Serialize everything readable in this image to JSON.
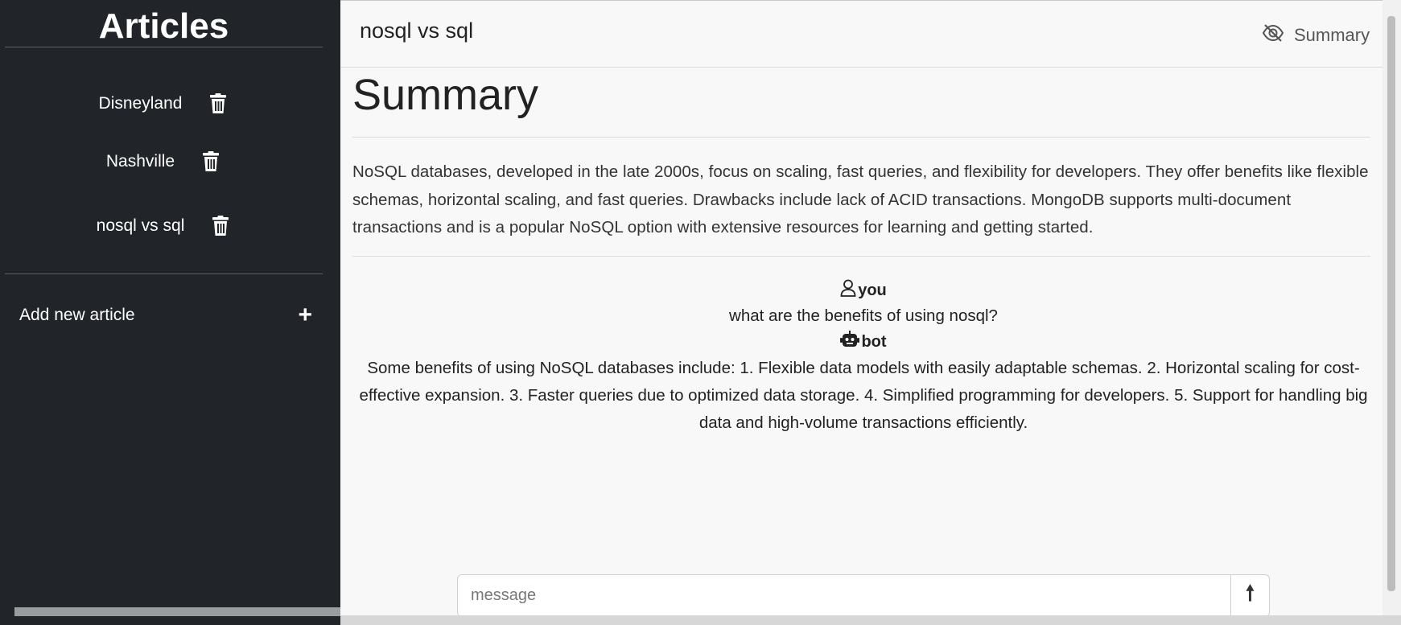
{
  "sidebar": {
    "title": "Articles",
    "articles": [
      {
        "label": "Disneyland",
        "icon": "trash-icon"
      },
      {
        "label": "Nashville",
        "icon": "trash-icon"
      },
      {
        "label": "nosql vs sql",
        "icon": "trash-icon"
      }
    ],
    "add_label": "Add new article",
    "add_icon": "+"
  },
  "header": {
    "title": "nosql vs sql",
    "summary_toggle_label": "Summary",
    "summary_toggle_icon": "eye-slash-icon"
  },
  "summary": {
    "heading": "Summary",
    "text": "NoSQL databases, developed in the late 2000s, focus on scaling, fast queries, and flexibility for developers. They offer benefits like flexible schemas, horizontal scaling, and fast queries. Drawbacks include lack of ACID transactions. MongoDB supports multi-document transactions and is a popular NoSQL option with extensive resources for learning and getting started."
  },
  "chat": {
    "messages": [
      {
        "author": "you",
        "icon": "person-icon",
        "text": "what are the benefits of using nosql?"
      },
      {
        "author": "bot",
        "icon": "robot-icon",
        "text": "Some benefits of using NoSQL databases include: 1. Flexible data models with easily adaptable schemas. 2. Horizontal scaling for cost-effective expansion. 3. Faster queries due to optimized data storage. 4. Simplified programming for developers. 5. Support for handling big data and high-volume transactions efficiently."
      }
    ]
  },
  "composer": {
    "placeholder": "message",
    "send_icon": "arrow-up-icon",
    "send_glyph": "🠕"
  },
  "colors": {
    "sidebar_bg": "#212529",
    "main_bg": "#f8f8f8"
  }
}
